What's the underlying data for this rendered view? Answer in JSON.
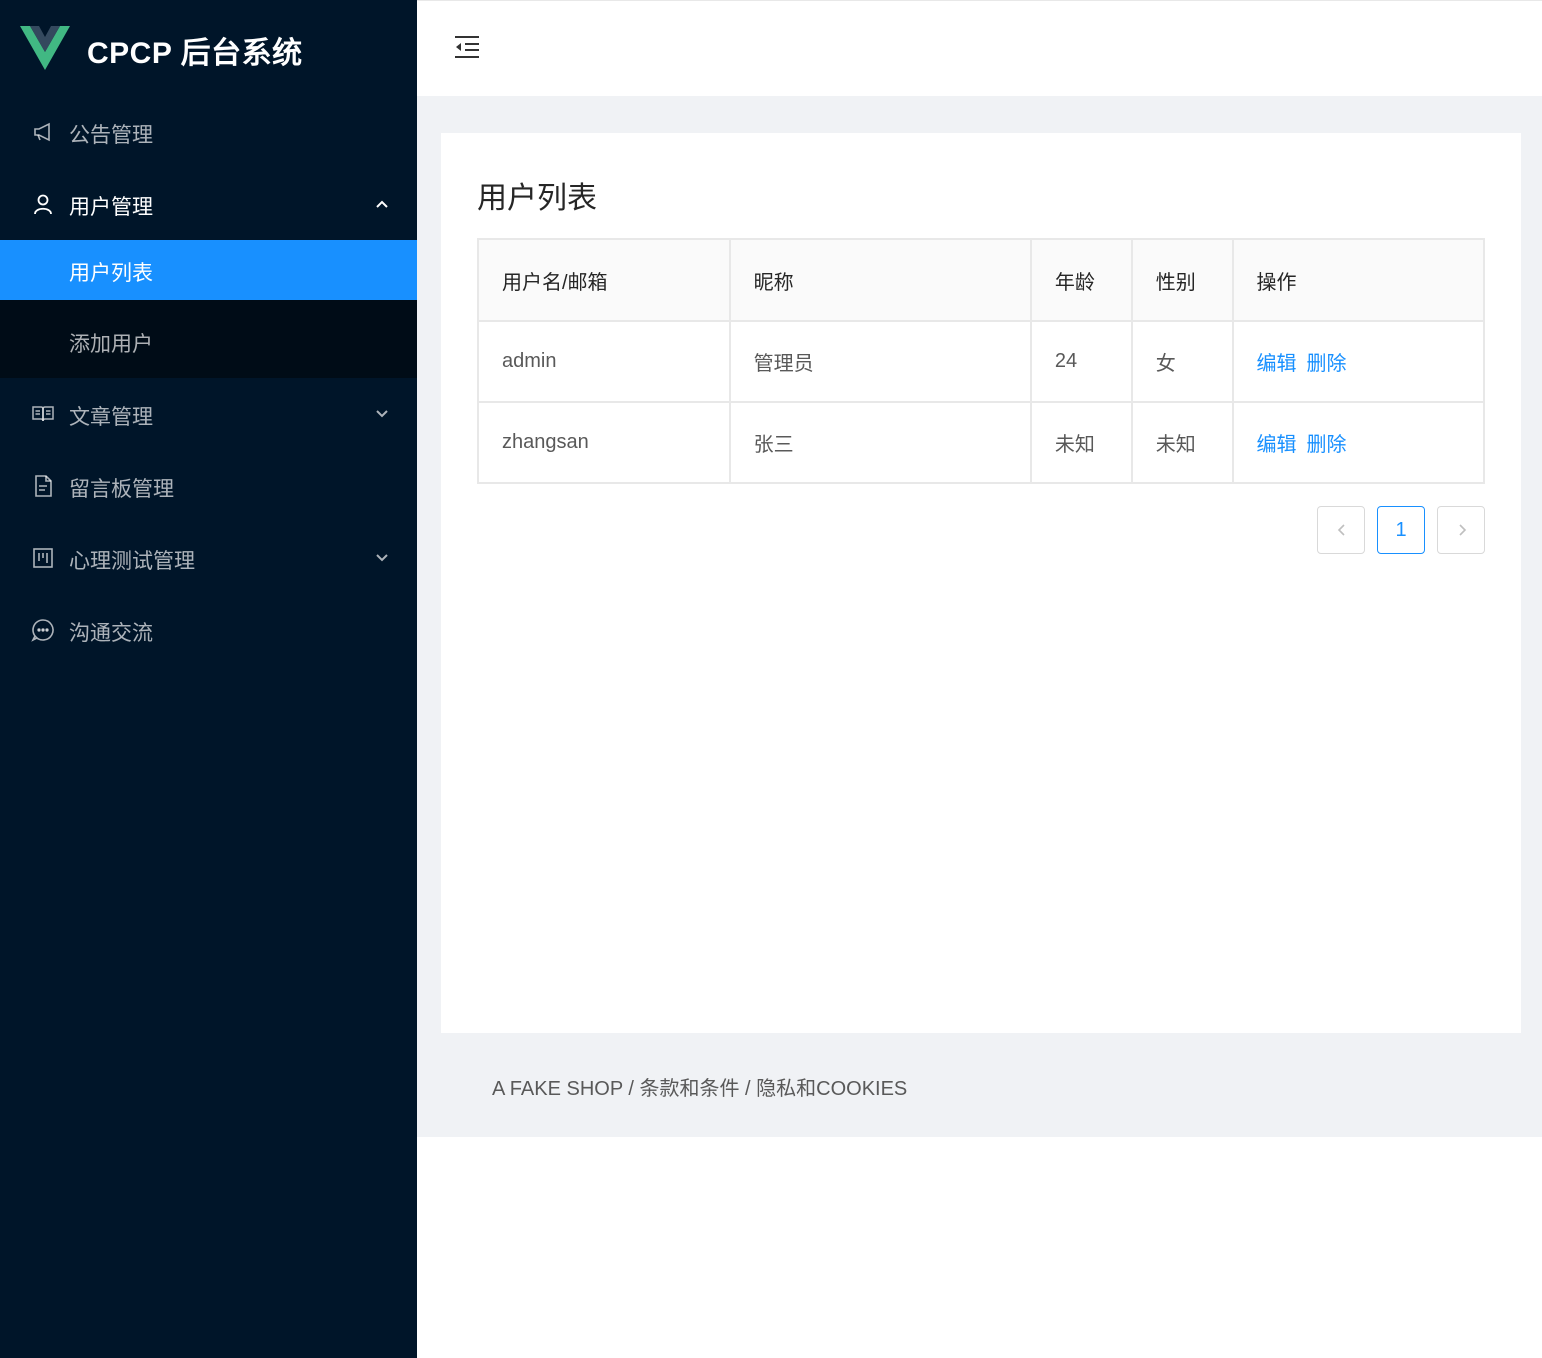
{
  "app": {
    "title": "CPCP 后台系统"
  },
  "sidebar": {
    "items": [
      {
        "label": "公告管理",
        "icon": "notification-icon"
      },
      {
        "label": "用户管理",
        "icon": "user-icon",
        "expanded": true,
        "children": [
          {
            "label": "用户列表",
            "active": true
          },
          {
            "label": "添加用户"
          }
        ]
      },
      {
        "label": "文章管理",
        "icon": "read-icon"
      },
      {
        "label": "留言板管理",
        "icon": "file-text-icon"
      },
      {
        "label": "心理测试管理",
        "icon": "project-icon"
      },
      {
        "label": "沟通交流",
        "icon": "message-icon"
      }
    ]
  },
  "main": {
    "title": "用户列表",
    "table": {
      "headers": [
        "用户名/邮箱",
        "昵称",
        "年龄",
        "性别",
        "操作"
      ],
      "rows": [
        {
          "username": "admin",
          "nickname": "管理员",
          "age": "24",
          "gender": "女",
          "edit": "编辑",
          "delete": "删除"
        },
        {
          "username": "zhangsan",
          "nickname": "张三",
          "age": "未知",
          "gender": "未知",
          "edit": "编辑",
          "delete": "删除"
        }
      ]
    },
    "pagination": {
      "current": "1"
    }
  },
  "footer": {
    "text": "A FAKE SHOP / 条款和条件 / 隐私和COOKIES"
  },
  "colors": {
    "sidebar": "#001529",
    "accent": "#1890ff",
    "submenu": "#000c17",
    "content_bg": "#f0f2f5"
  }
}
